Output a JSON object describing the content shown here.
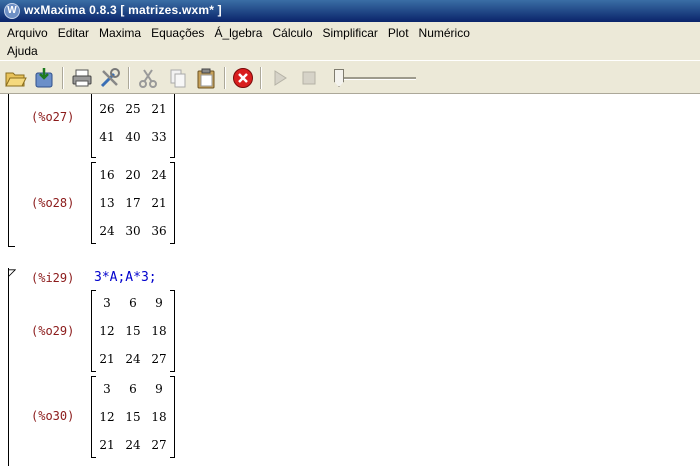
{
  "window": {
    "title": "wxMaxima 0.8.3  [ matrizes.wxm* ]",
    "icon_glyph": "W"
  },
  "menu": {
    "row1": [
      "Arquivo",
      "Editar",
      "Maxima",
      "Equações",
      "Á_lgebra",
      "Cálculo",
      "Simplificar",
      "Plot",
      "Numérico"
    ],
    "row2": [
      "Ajuda"
    ]
  },
  "toolbar": {
    "icons": [
      "open-folder-icon",
      "save-icon",
      "print-icon",
      "preferences-tools-icon",
      "cut-icon",
      "copy-icon",
      "paste-icon",
      "interrupt-stop-icon",
      "play-icon",
      "stop-icon"
    ],
    "slider_value": 0
  },
  "cells": [
    {
      "label": "(%o27)",
      "rows": [
        [
          "26",
          "25",
          "21"
        ],
        [
          "41",
          "40",
          "33"
        ]
      ],
      "partial_top": true
    },
    {
      "label": "(%o28)",
      "rows": [
        [
          "16",
          "20",
          "24"
        ],
        [
          "13",
          "17",
          "21"
        ],
        [
          "24",
          "30",
          "36"
        ]
      ]
    },
    {
      "input_label": "(%i29)",
      "input": "3*A;A*3;"
    },
    {
      "label": "(%o29)",
      "rows": [
        [
          "3",
          "6",
          "9"
        ],
        [
          "12",
          "15",
          "18"
        ],
        [
          "21",
          "24",
          "27"
        ]
      ]
    },
    {
      "label": "(%o30)",
      "rows": [
        [
          "3",
          "6",
          "9"
        ],
        [
          "12",
          "15",
          "18"
        ],
        [
          "21",
          "24",
          "27"
        ]
      ]
    }
  ]
}
